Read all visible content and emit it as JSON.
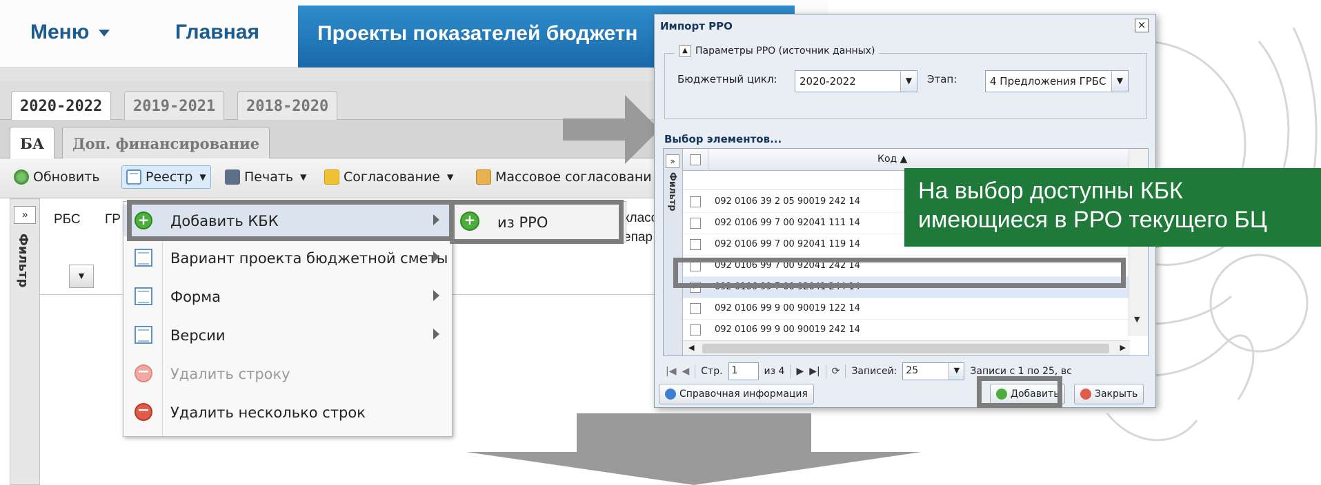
{
  "topnav": {
    "menu_label": "Меню",
    "home_label": "Главная",
    "projects_label": "Проекты показателей бюджетн"
  },
  "year_tabs": [
    "2020-2022",
    "2019-2021",
    "2018-2020"
  ],
  "sub_tabs": [
    "БА",
    "Доп. финансирование"
  ],
  "toolbar": {
    "refresh": "Обновить",
    "registry": "Реестр",
    "print": "Печать",
    "approval": "Согласование",
    "mass_approval": "Массовое согласовани"
  },
  "grid": {
    "filter_label": "Фильтр",
    "col_rbs": "РБС",
    "col_gr": "ГР",
    "col_right1": "класс",
    "col_right2": "епар"
  },
  "context_menu": {
    "items": [
      {
        "label": "Добавить КБК",
        "icon": "add-icon"
      },
      {
        "label": "Вариант проекта бюджетной сметы",
        "icon": "grid-icon"
      },
      {
        "label": "Форма",
        "icon": "grid-icon"
      },
      {
        "label": "Версии",
        "icon": "grid-icon"
      },
      {
        "label": "Удалить строку",
        "icon": "remove-icon"
      },
      {
        "label": "Удалить несколько строк",
        "icon": "remove-icon"
      }
    ],
    "submenu_item": "из РРО"
  },
  "dialog": {
    "title": "Импорт РРО",
    "close": "×",
    "params_legend": "Параметры РРО (источник данных)",
    "cycle_label": "Бюджетный цикл:",
    "cycle_value": "2020-2022",
    "stage_label": "Этап:",
    "stage_value": "4 Предложения ГРБС",
    "select_heading": "Выбор элементов...",
    "filter_label": "Фильтр",
    "code_header": "Код",
    "rows": [
      {
        "code": "092 0106 39 2 05 90019 242 14",
        "checked": false
      },
      {
        "code": "092 0106 99 7 00 92041 111 14",
        "checked": false
      },
      {
        "code": "092 0106 99 7 00 92041 119 14",
        "checked": false
      },
      {
        "code": "092 0106 99 7 00 92041 242 14",
        "checked": false
      },
      {
        "code": "092 0106 99 7 00 92041 244 14",
        "checked": true
      },
      {
        "code": "092 0106 99 9 00 90019 122 14",
        "checked": false
      },
      {
        "code": "092 0106 99 9 00 90019 242 14",
        "checked": false
      }
    ],
    "pager": {
      "page_label": "Стр.",
      "page_value": "1",
      "of_label": "из 4",
      "records_label": "Записей:",
      "records_value": "25",
      "summary": "Записи с 1 по 25, вс"
    },
    "help_button": "Справочная информация",
    "add_button": "Добавить",
    "close_button": "Закрыть"
  },
  "callout": {
    "line1": "На выбор доступны КБК",
    "line2": "имеющиеся в РРО текущего БЦ"
  },
  "colors": {
    "nav_blue": "#1c5c8f",
    "active_tab": "#1a6aa8",
    "callout_green": "#1f7a3a",
    "highlight_box": "#7d7d7d"
  }
}
